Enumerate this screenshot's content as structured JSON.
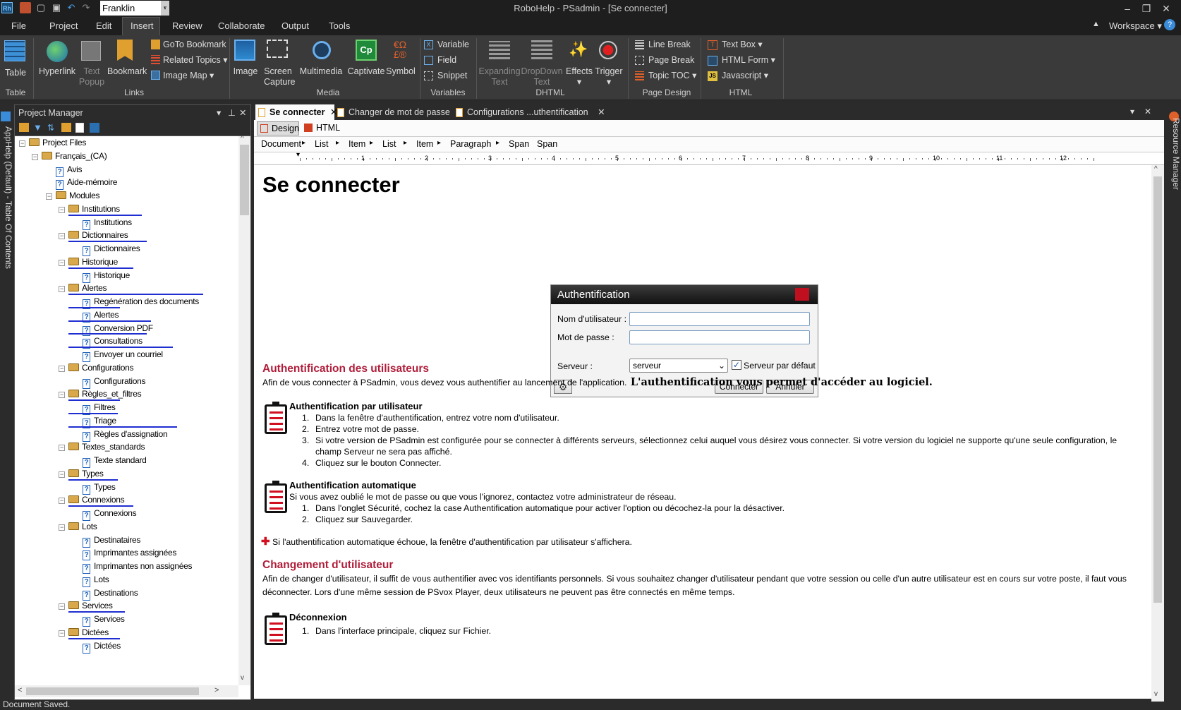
{
  "app": {
    "title": "RoboHelp - PSadmin - [Se connecter]",
    "font_name": "Franklin Gothic",
    "logo": "Rh"
  },
  "menu": [
    "File",
    "Project",
    "Edit",
    "Insert",
    "Review",
    "Collaborate",
    "Output",
    "Tools"
  ],
  "workspace_label": "Workspace",
  "ribbon": {
    "table": {
      "button": "Table",
      "group": "Table"
    },
    "links": {
      "hyperlink": "Hyperlink",
      "text_popup_1": "Text",
      "text_popup_2": "Popup",
      "bookmark": "Bookmark",
      "goto_bookmark": "GoTo Bookmark",
      "related_topics": "Related Topics",
      "image_map": "Image Map",
      "group": "Links"
    },
    "media": {
      "image": "Image",
      "screen_capture_1": "Screen",
      "screen_capture_2": "Capture",
      "multimedia": "Multimedia",
      "captivate": "Captivate",
      "symbol": "Symbol",
      "group": "Media"
    },
    "variables": {
      "variable": "Variable",
      "field": "Field",
      "snippet": "Snippet",
      "group": "Variables"
    },
    "dhtml": {
      "expanding_1": "Expanding",
      "expanding_2": "Text",
      "dropdown_1": "DropDown",
      "dropdown_2": "Text",
      "effects": "Effects",
      "trigger": "Trigger",
      "group": "DHTML"
    },
    "page_design": {
      "line_break": "Line Break",
      "page_break": "Page Break",
      "topic_toc": "Topic TOC",
      "group": "Page Design"
    },
    "html": {
      "text_box": "Text Box",
      "html_form": "HTML Form",
      "javascript": "Javascript",
      "group": "HTML"
    }
  },
  "left_strip_label": "AppHelp (Default) - Table Of Contents",
  "right_strip_label": "Resource Manager",
  "project_manager": {
    "title": "Project Manager",
    "tree": [
      {
        "label": "Project Files",
        "type": "folder",
        "level": 0
      },
      {
        "label": "Français_(CA)",
        "type": "folder",
        "level": 1
      },
      {
        "label": "Avis",
        "type": "page",
        "level": 2
      },
      {
        "label": "Aide-mémoire",
        "type": "page",
        "level": 2
      },
      {
        "label": "Modules",
        "type": "folder",
        "level": 2
      },
      {
        "label": "Institutions",
        "type": "folder",
        "level": 3
      },
      {
        "label": "Institutions",
        "type": "page",
        "level": 4,
        "ul": true
      },
      {
        "label": "Dictionnaires",
        "type": "folder",
        "level": 3
      },
      {
        "label": "Dictionnaires",
        "type": "page",
        "level": 4,
        "ul": true
      },
      {
        "label": "Historique",
        "type": "folder",
        "level": 3
      },
      {
        "label": "Historique",
        "type": "page",
        "level": 4,
        "ul": true
      },
      {
        "label": "Alertes",
        "type": "folder",
        "level": 3
      },
      {
        "label": "Regénération des documents",
        "type": "page",
        "level": 4,
        "ul": true
      },
      {
        "label": "Alertes",
        "type": "page",
        "level": 4,
        "ul": true
      },
      {
        "label": "Conversion PDF",
        "type": "page",
        "level": 4,
        "ul": true
      },
      {
        "label": "Consultations",
        "type": "page",
        "level": 4,
        "ul": true
      },
      {
        "label": "Envoyer un courriel",
        "type": "page",
        "level": 4,
        "ul": true
      },
      {
        "label": "Configurations",
        "type": "folder",
        "level": 3
      },
      {
        "label": "Configurations",
        "type": "page",
        "level": 4
      },
      {
        "label": "Règles_et_filtres",
        "type": "folder",
        "level": 3
      },
      {
        "label": "Filtres",
        "type": "page",
        "level": 4,
        "ul": true
      },
      {
        "label": "Triage",
        "type": "page",
        "level": 4,
        "ul": true
      },
      {
        "label": "Règles d'assignation",
        "type": "page",
        "level": 4,
        "ul": true
      },
      {
        "label": "Textes_standards",
        "type": "folder",
        "level": 3
      },
      {
        "label": "Texte standard",
        "type": "page",
        "level": 4
      },
      {
        "label": "Types",
        "type": "folder",
        "level": 3
      },
      {
        "label": "Types",
        "type": "page",
        "level": 4,
        "ul": true
      },
      {
        "label": "Connexions",
        "type": "folder",
        "level": 3
      },
      {
        "label": "Connexions",
        "type": "page",
        "level": 4,
        "ul": true
      },
      {
        "label": "Lots",
        "type": "folder",
        "level": 3
      },
      {
        "label": "Destinataires",
        "type": "page",
        "level": 4
      },
      {
        "label": "Imprimantes assignées",
        "type": "page",
        "level": 4
      },
      {
        "label": "Imprimantes non assignées",
        "type": "page",
        "level": 4
      },
      {
        "label": "Lots",
        "type": "page",
        "level": 4
      },
      {
        "label": "Destinations",
        "type": "page",
        "level": 4
      },
      {
        "label": "Services",
        "type": "folder",
        "level": 3
      },
      {
        "label": "Services",
        "type": "page",
        "level": 4,
        "ul": true
      },
      {
        "label": "Dictées",
        "type": "folder",
        "level": 3
      },
      {
        "label": "Dictées",
        "type": "page",
        "level": 4,
        "ul": true
      }
    ]
  },
  "editor": {
    "tabs": [
      "Se connecter",
      "Changer de mot de passe",
      "Configurations ...uthentification"
    ],
    "view_design": "Design",
    "view_html": "HTML",
    "breadcrumb": [
      "Document",
      "List",
      "Item",
      "List",
      "Item",
      "Paragraph",
      "Span",
      "Span"
    ],
    "ruler": [
      "1",
      "2",
      "3",
      "4",
      "5",
      "6",
      "7",
      "8",
      "9",
      "10",
      "11",
      "12"
    ]
  },
  "doc": {
    "title": "Se connecter",
    "auth_dialog": {
      "title": "Authentification",
      "username_label": "Nom d'utilisateur :",
      "password_label": "Mot de passe :",
      "server_label": "Serveur :",
      "server_value": "serveur",
      "default_server": "Serveur par défaut",
      "connect": "Connecter",
      "cancel": "Annuler"
    },
    "s1_title": "Authentification des utilisateurs",
    "s1_text": "Afin de vous connecter à PSadmin, vous devez vous authentifier au lancement de l'application.",
    "s1_bold": "L'authentification vous permet d'accéder au logiciel.",
    "s2_title": "Authentification par utilisateur",
    "s2_steps": [
      "Dans la fenêtre d'authentification, entrez votre nom d'utilisateur.",
      "Entrez votre mot de passe.",
      "Si votre version de PSadmin est configurée pour se connecter à différents serveurs, sélectionnez celui auquel vous désirez vous connecter. Si votre version du logiciel ne supporte qu'une seule configuration, le",
      "champ Serveur ne sera pas affiché.",
      "Cliquez sur le bouton Connecter."
    ],
    "s3_title": "Authentification automatique",
    "s3_intro": "Si vous avez oublié le mot de passe ou que vous l'ignorez, contactez votre administrateur de réseau.",
    "s3_steps": [
      "Dans l'onglet Sécurité, cochez la case Authentification automatique pour activer l'option ou décochez-la pour la désactiver.",
      "Cliquez sur Sauvegarder."
    ],
    "note": "Si l'authentification automatique échoue, la fenêtre d'authentification par utilisateur s'affichera.",
    "s4_title": "Changement d'utilisateur",
    "s4_text_1": " Afin de changer d'utilisateur, il suffit de vous authentifier avec vos identifiants personnels. Si vous souhaitez changer d'utilisateur pendant que votre session ou celle d'un autre utilisateur est en cours sur votre poste, il faut vous",
    "s4_text_2": "déconnecter. Lors d'une même session de PSvox Player, deux utilisateurs ne peuvent pas être connectés en même temps.",
    "s5_title": "Déconnexion",
    "s5_steps": [
      "Dans l'interface principale, cliquez sur Fichier."
    ],
    "nums": [
      "1.",
      "2.",
      "3.",
      "4."
    ]
  },
  "status": "Document Saved.",
  "colors": {
    "accent_red": "#b01d3a",
    "link_blue": "#1f2ed0",
    "dark_bg": "#2b2b2b"
  }
}
